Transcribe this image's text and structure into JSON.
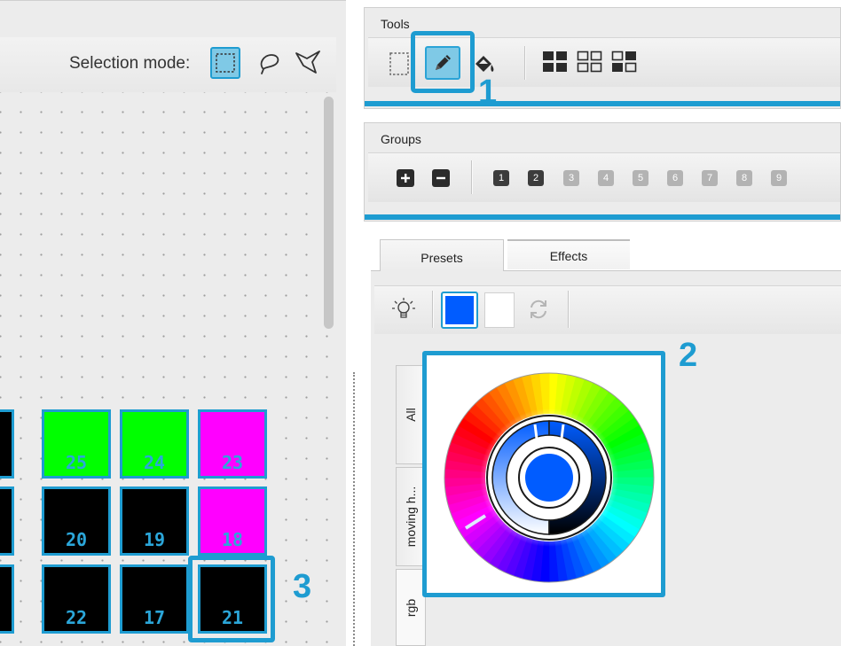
{
  "selection": {
    "label": "Selection mode:"
  },
  "tools": {
    "title": "Tools"
  },
  "groups": {
    "title": "Groups",
    "numbers": [
      "1",
      "2",
      "3",
      "4",
      "5",
      "6",
      "7",
      "8",
      "9"
    ]
  },
  "tabs": {
    "presets": "Presets",
    "effects": "Effects"
  },
  "preset_categories": [
    "All",
    "moving h...",
    "rgb"
  ],
  "fixtures": {
    "row1": [
      "25",
      "24",
      "23"
    ],
    "row2": [
      "20",
      "19",
      "18"
    ],
    "row3": [
      "22",
      "17",
      "21"
    ]
  },
  "callouts": {
    "one": "1",
    "two": "2",
    "three": "3"
  },
  "colors": {
    "accent": "#1e9cd1",
    "fixture_green": "#00ff00",
    "fixture_magenta": "#ff00ff",
    "fixture_black": "#000000",
    "selected_color": "#005cff"
  },
  "icons": {
    "tools": [
      "rect-select-icon",
      "pencil-icon",
      "paint-bucket-icon",
      "grid-fill-icon",
      "grid-empty-icon",
      "grid-mixed-icon"
    ],
    "groups": [
      "plus-icon",
      "minus-icon"
    ],
    "presets": [
      "light-bulb-icon",
      "swap-icon"
    ],
    "selection": [
      "rect-select-icon",
      "lasso-icon",
      "polygon-select-icon"
    ]
  }
}
